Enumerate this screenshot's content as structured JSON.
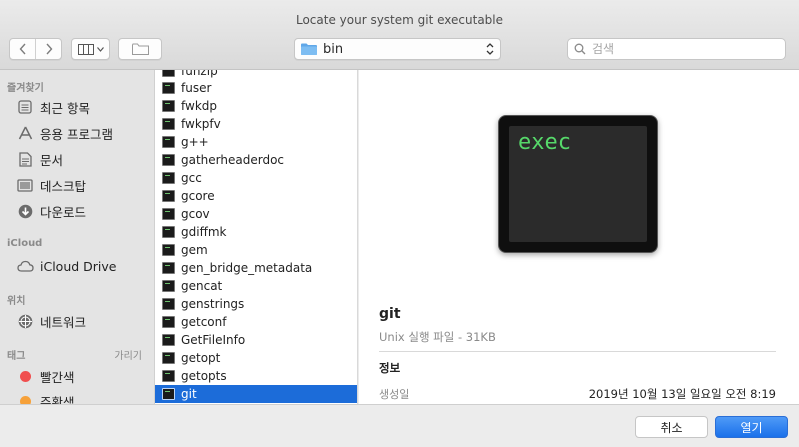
{
  "window": {
    "title": "Locate your system git executable"
  },
  "toolbar": {
    "path_label": "bin",
    "search_placeholder": "검색"
  },
  "sidebar": {
    "favorites_header": "즐겨찾기",
    "favorites": [
      {
        "label": "최근 항목",
        "icon": "recents-icon"
      },
      {
        "label": "응용 프로그램",
        "icon": "applications-icon"
      },
      {
        "label": "문서",
        "icon": "documents-icon"
      },
      {
        "label": "데스크탑",
        "icon": "desktop-icon"
      },
      {
        "label": "다운로드",
        "icon": "downloads-icon"
      }
    ],
    "icloud_header": "iCloud",
    "icloud_items": [
      {
        "label": "iCloud Drive",
        "icon": "cloud-icon"
      }
    ],
    "locations_header": "위치",
    "locations": [
      {
        "label": "네트워크",
        "icon": "network-icon"
      }
    ],
    "tags_header": "태그",
    "tags_action": "가리기",
    "tags": [
      {
        "label": "빨간색",
        "color": "#f04e4e"
      },
      {
        "label": "주황색",
        "color": "#f6a13a"
      }
    ]
  },
  "files": [
    "funzip",
    "fuser",
    "fwkdp",
    "fwkpfv",
    "g++",
    "gatherheaderdoc",
    "gcc",
    "gcore",
    "gcov",
    "gdiffmk",
    "gem",
    "gen_bridge_metadata",
    "gencat",
    "genstrings",
    "getconf",
    "GetFileInfo",
    "getopt",
    "getopts",
    "git"
  ],
  "selected_file": "git",
  "preview": {
    "icon_text": "exec",
    "name": "git",
    "kind": "Unix 실행 파일 - 31KB",
    "info_header": "정보",
    "created_label": "생성일",
    "created_value": "2019년 10월 13일 일요일 오전 8:19"
  },
  "buttons": {
    "cancel": "취소",
    "open": "열기"
  }
}
